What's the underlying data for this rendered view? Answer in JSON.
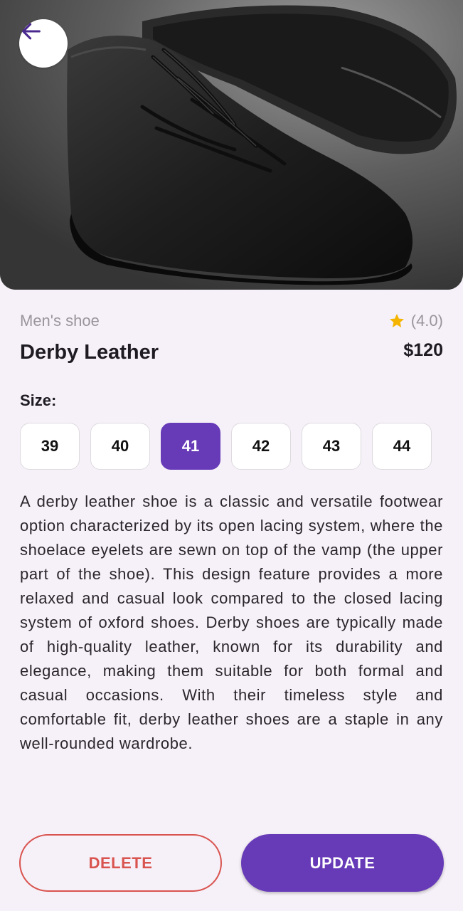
{
  "product": {
    "category": "Men's shoe",
    "rating_text": "(4.0)",
    "name": "Derby Leather",
    "price": "$120",
    "description": "A derby leather shoe is a classic and versatile footwear option characterized by its open lacing system, where the shoelace eyelets are sewn on top of the vamp (the upper part of the shoe). This design feature provides a more relaxed and casual look compared to the closed lacing system of oxford shoes. Derby shoes are typically made of high-quality leather, known for its durability and elegance, making them suitable for both formal and casual occasions. With their timeless style and comfortable fit, derby leather shoes are a staple in any well-rounded wardrobe."
  },
  "sizes": {
    "label": "Size:",
    "options": [
      "39",
      "40",
      "41",
      "42",
      "43",
      "44"
    ],
    "selected": "41"
  },
  "actions": {
    "delete_label": "DELETE",
    "update_label": "UPDATE"
  },
  "icons": {
    "back": "arrow-left-icon",
    "rating": "star-icon"
  },
  "colors": {
    "accent": "#673ab7",
    "danger": "#d9534f",
    "star": "#f5b400",
    "background": "#f6f1f8"
  }
}
